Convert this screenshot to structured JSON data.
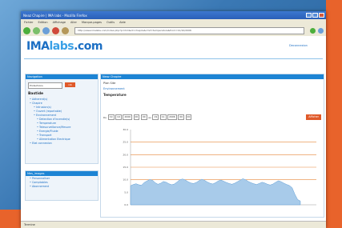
{
  "window": {
    "title": "Neaz Chapire | IMA labs - Mozilla Firefox"
  },
  "menubar": [
    "Fichier",
    "Edition",
    "Affichage",
    "Aller",
    "Marque-pages",
    "Outils",
    "Aide"
  ],
  "toolbar": {
    "url": "http://www.imalabs.com/index.php?p=ihm&id=chapire&cmd=temperature&from=12/10/2006"
  },
  "logo": {
    "main": "IMA",
    "accent": "labs",
    "suffix": ".com"
  },
  "logout": "Deconnexion",
  "left_panel": {
    "head": "Navigation",
    "select_value": "Protections",
    "go_label": "OK",
    "section": "Bastide",
    "tree": [
      {
        "level": 1,
        "label": "Adherent(s)"
      },
      {
        "level": 1,
        "label": "Chapire"
      },
      {
        "level": 2,
        "label": "Intrusion(s)"
      },
      {
        "level": 2,
        "label": "Ouvert (reportable)"
      },
      {
        "level": 2,
        "label": "Environnement"
      },
      {
        "level": 3,
        "label": "Detection d'incendie(s)"
      },
      {
        "level": 3,
        "label": "Temperature"
      },
      {
        "level": 3,
        "label": "Telesurveillance/Mesure"
      },
      {
        "level": 3,
        "label": "Energie/Fluide"
      },
      {
        "level": 3,
        "label": "Transport"
      },
      {
        "level": 3,
        "label": "Alimentation Electrique"
      },
      {
        "level": 1,
        "label": "Etat connexion"
      }
    ]
  },
  "left_panel2": {
    "head": "Mes_images",
    "items": [
      "Personnaliser",
      "Comptables",
      "Abonnement"
    ]
  },
  "main_panel": {
    "head": "Neaz Chapire",
    "line1": "Plan Site",
    "crumb": "Environnement",
    "title": "Temperature"
  },
  "daterange": {
    "from_label": "Du",
    "to_label": "au",
    "from": [
      "19",
      "10",
      "2006",
      "00",
      "00"
    ],
    "to": [
      "19",
      "11",
      "2006",
      "00",
      "00"
    ],
    "button": "Afficher"
  },
  "statusbar": "Termine",
  "colors": {
    "accent_orange": "#e05a2a",
    "brand_blue": "#1c6fc4",
    "area_fill": "#a8cbea",
    "guide_line": "#e8883a"
  },
  "chart_data": {
    "type": "area",
    "title": "",
    "xlabel": "",
    "ylabel": "",
    "y_ticks": [
      "30.0",
      "25.0",
      "20.0",
      "15.0",
      "10.0",
      "5.0",
      "0.0"
    ],
    "ylim": [
      0,
      30
    ],
    "guide_lines": [
      25,
      20,
      15,
      10
    ],
    "values": [
      7.6,
      8.1,
      8.4,
      8.0,
      7.8,
      8.9,
      9.5,
      10.1,
      9.8,
      8.8,
      8.2,
      8.6,
      9.3,
      9.0,
      8.4,
      8.0,
      8.3,
      9.1,
      10.0,
      10.3,
      9.9,
      9.2,
      8.7,
      8.5,
      8.9,
      9.6,
      10.2,
      9.8,
      9.1,
      8.6,
      8.3,
      8.8,
      9.5,
      9.9,
      9.4,
      8.9,
      8.5,
      8.2,
      8.6,
      9.2,
      9.8,
      10.4,
      10.0,
      9.3,
      8.8,
      8.4,
      8.1,
      8.5,
      9.0,
      8.7,
      8.2,
      7.9,
      8.3,
      9.0,
      9.6,
      9.2,
      8.6,
      8.1,
      7.7,
      6.8,
      4.2,
      2.1,
      1.5
    ]
  }
}
